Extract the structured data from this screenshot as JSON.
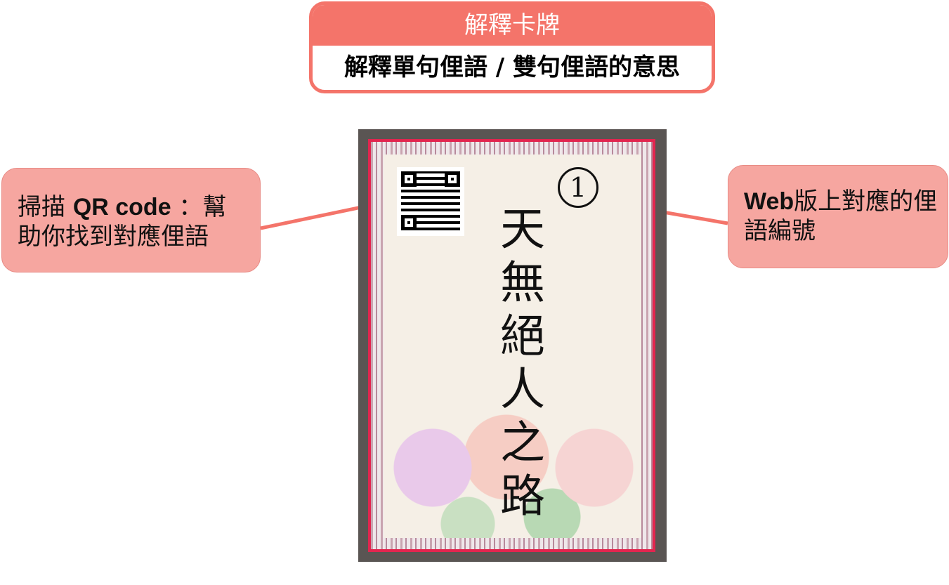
{
  "header": {
    "title": "解釋卡牌",
    "subtitle": "解釋單句俚語 / 雙句俚語的意思"
  },
  "callouts": {
    "left": {
      "bold": "QR code",
      "prefix": "掃描 ",
      "suffix": " ：幫助你找到對應俚語"
    },
    "right": {
      "bold": "Web",
      "suffix": "版上對應的俚語編號"
    }
  },
  "card": {
    "number": "1",
    "text": "天無絕人之路"
  },
  "colors": {
    "accent": "#f4746a",
    "callout": "#f6a6a0",
    "card_border": "#e2254f",
    "card_bg": "#5a5553"
  }
}
